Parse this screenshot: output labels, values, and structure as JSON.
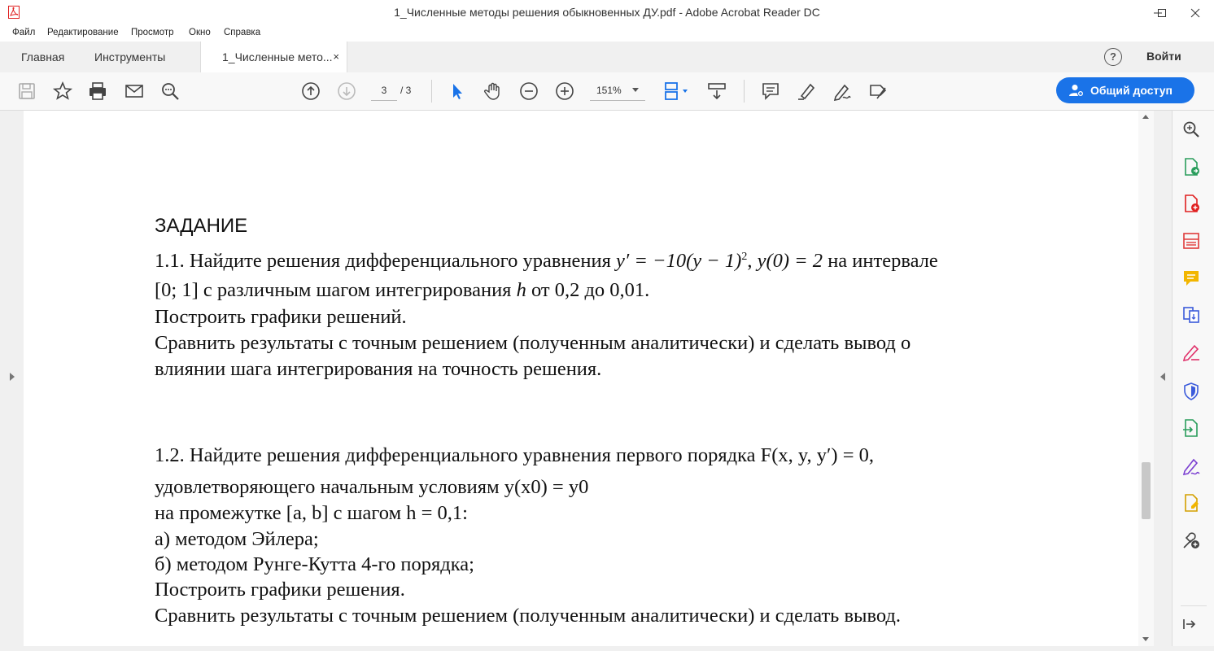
{
  "window": {
    "title": "1_Численные методы решения обыкновенных ДУ.pdf - Adobe Acrobat Reader DC"
  },
  "menu": [
    "Файл",
    "Редактирование",
    "Просмотр",
    "Окно",
    "Справка"
  ],
  "tabs": {
    "home": "Главная",
    "tools": "Инструменты",
    "document": "1_Численные мето...",
    "close": "×"
  },
  "header_right": {
    "help": "?",
    "signin": "Войти"
  },
  "toolbar": {
    "page_current": "3",
    "page_total": "/ 3",
    "zoom": "151%",
    "share_label": "Общий доступ"
  },
  "colors": {
    "accent": "#1a73e8",
    "pdf_red": "#e02020"
  },
  "document": {
    "heading": "ЗАДАНИЕ",
    "task1": {
      "l1_a": "1.1. Найдите решения дифференциального уравнения ",
      "l1_eq1": "y′ = −10(y − 1)",
      "l1_exp": "2",
      "l1_sep": ",  ",
      "l1_eq2": "y(0) = 2",
      "l1_b": " на интервале",
      "l2_a": "[0; 1] с различным шагом интегрирования ",
      "l2_h": "h",
      "l2_b": " от 0,2 до 0,01.",
      "l3": "Построить графики решений.",
      "l4": "Сравнить результаты с точным решением (полученным аналитически) и сделать вывод о",
      "l5": "влиянии шага интегрирования на точность решения."
    },
    "task2": {
      "l1": "1.2. Найдите решения дифференциального уравнения первого порядка F(x, y, y′) = 0,",
      "l2": "удовлетворяющего начальным условиям y(x0) = y0",
      "l3": "на промежутке [a, b] с шагом h = 0,1:",
      "l4": "а) методом Эйлера;",
      "l5": "б) методом Рунге-Кутта 4-го порядка;",
      "l6": "Построить графики решения.",
      "l7": "Сравнить результаты с точным решением (полученным аналитически) и сделать вывод."
    }
  }
}
